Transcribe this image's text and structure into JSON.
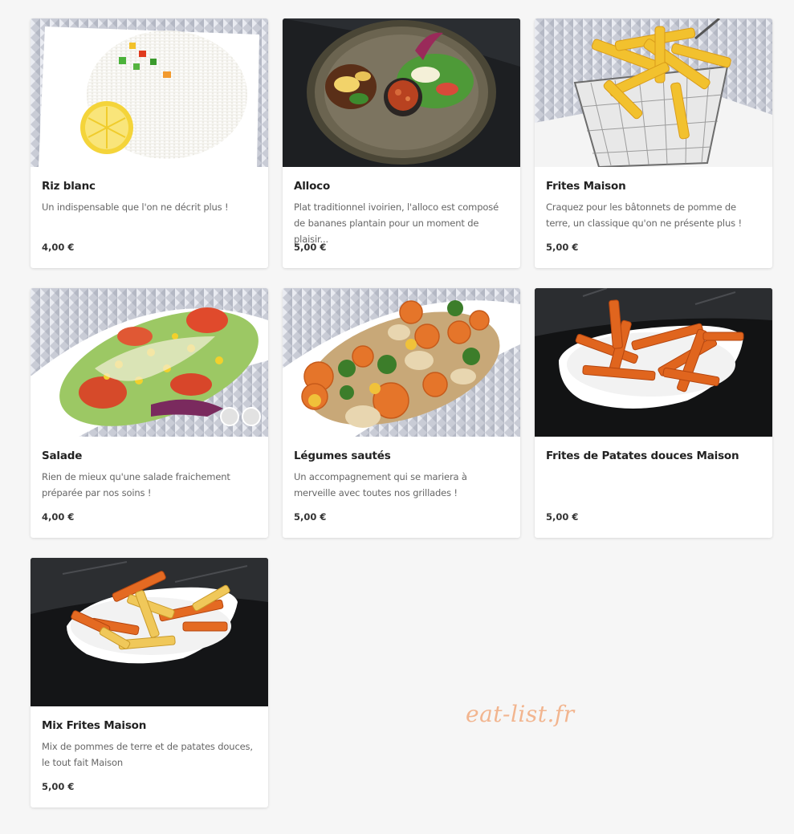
{
  "items": [
    {
      "name": "Riz blanc",
      "description": "Un indispensable que l'on ne décrit plus !",
      "price": "4,00 €",
      "image": "white-rice-with-lemon"
    },
    {
      "name": "Alloco",
      "description": "Plat traditionnel ivoirien, l'alloco est composé de bananes plantain pour un moment de plaisir...",
      "price": "5,00 €",
      "image": "alloco-plantain-plate"
    },
    {
      "name": "Frites Maison",
      "description": "Craquez pour les bâtonnets de pomme de terre, un classique qu'on ne présente plus !",
      "price": "5,00 €",
      "image": "fries-in-wire-basket"
    },
    {
      "name": "Salade",
      "description": "Rien de mieux qu'une salade fraichement préparée par nos soins !",
      "price": "4,00 €",
      "image": "mixed-salad"
    },
    {
      "name": "Légumes sautés",
      "description": "Un accompagnement qui se mariera à merveille avec toutes nos grillades !",
      "price": "5,00 €",
      "image": "sauteed-vegetables"
    },
    {
      "name": "Frites de Patates douces Maison",
      "description": "",
      "price": "5,00 €",
      "image": "sweet-potato-fries"
    },
    {
      "name": "Mix Frites Maison",
      "description": "Mix de pommes de terre et de patates douces, le tout fait Maison",
      "price": "5,00 €",
      "image": "mixed-fries"
    }
  ],
  "watermark": "eat-list.fr",
  "colors": {
    "background": "#f6f6f6",
    "card": "#ffffff",
    "watermark": "#f2b58f"
  }
}
